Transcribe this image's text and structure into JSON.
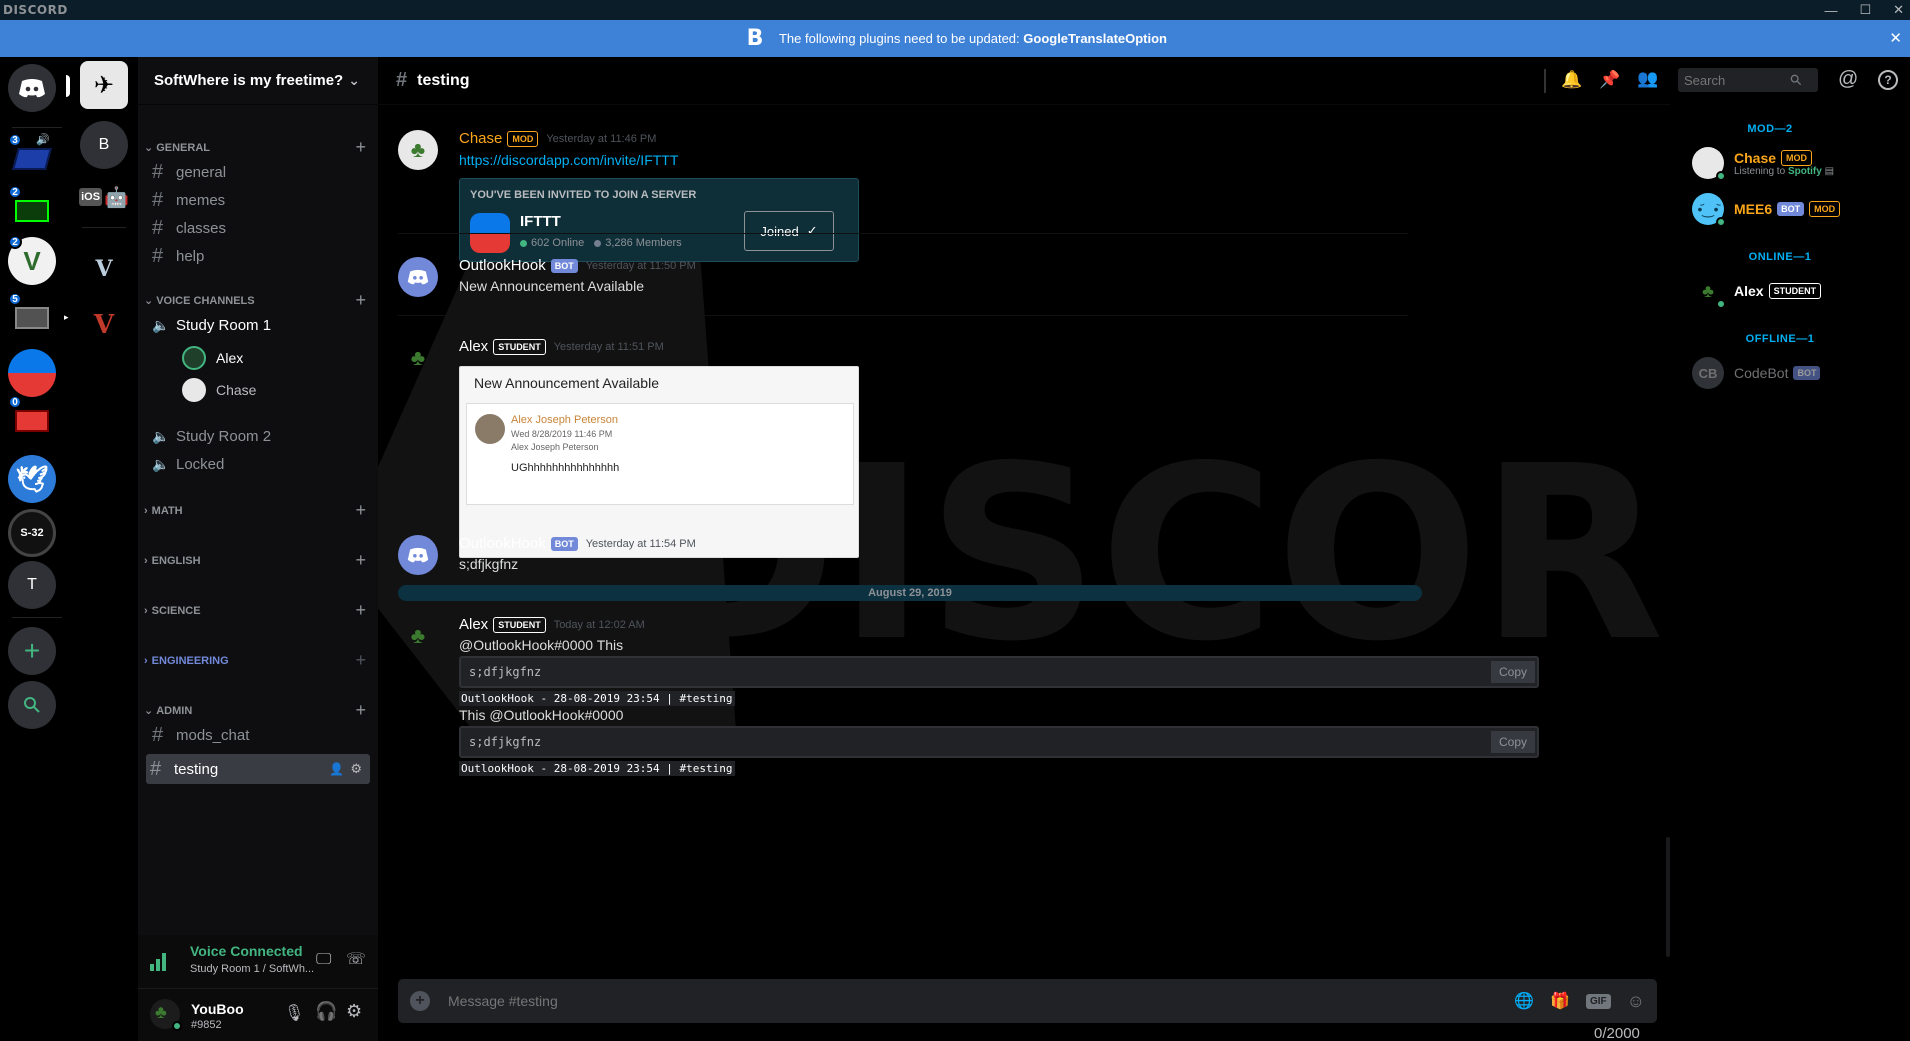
{
  "window": {
    "brand": "DISCORD",
    "minimize": "—",
    "maximize": "☐",
    "close": "✕"
  },
  "banner": {
    "logo": "B",
    "text_prefix": "The following plugins need to be updated: ",
    "plugin": "GoogleTranslateOption",
    "close": "✕"
  },
  "guilds": {
    "badges": [
      "3",
      "2",
      "2",
      "5",
      "0"
    ],
    "b_letter": "B",
    "t_letter": "T",
    "s32": "S-32",
    "ios": "iOS"
  },
  "server": {
    "name": "SoftWhere is my freetime?"
  },
  "categories": {
    "general": "GENERAL",
    "voice": "VOICE CHANNELS",
    "math": "MATH",
    "english": "ENGLISH",
    "science": "SCIENCE",
    "engineering": "ENGINEERING",
    "admin": "ADMIN"
  },
  "channels": {
    "general": "general",
    "memes": "memes",
    "classes": "classes",
    "help": "help",
    "study1": "Study Room 1",
    "study2": "Study Room 2",
    "locked": "Locked",
    "mods_chat": "mods_chat",
    "testing": "testing"
  },
  "voice_users": [
    "Alex",
    "Chase"
  ],
  "voice_status": {
    "title": "Voice Connected",
    "sub": "Study Room 1 / SoftWh..."
  },
  "user": {
    "name": "YouBoo",
    "tag": "#9852"
  },
  "header": {
    "channel": "testing",
    "search_placeholder": "Search"
  },
  "messages": {
    "m1": {
      "author": "Chase",
      "tag": "MOD",
      "time": "Yesterday at 11:46 PM",
      "link": "https://discordapp.com/invite/IFTTT",
      "invite": {
        "heading": "YOU'VE BEEN INVITED TO JOIN A SERVER",
        "server": "IFTTT",
        "online": "602 Online",
        "members": "3,286 Members",
        "button": "Joined"
      }
    },
    "m2": {
      "author": "OutlookHook",
      "tag": "BOT",
      "time": "Yesterday at 11:50 PM",
      "text": "New Announcement Available"
    },
    "m3": {
      "author": "Alex",
      "tag": "STUDENT",
      "time": "Yesterday at 11:51 PM",
      "embed": {
        "title": "New Announcement Available",
        "sender": "Alex Joseph Peterson",
        "date": "Wed 8/28/2019 11:46 PM",
        "to": "Alex Joseph Peterson",
        "body": "UGhhhhhhhhhhhhhhh"
      }
    },
    "m4": {
      "author": "OutlookHook",
      "tag": "BOT",
      "time": "Yesterday at 11:54 PM",
      "text": "s;dfjkgfnz"
    },
    "divider": "August 29, 2019",
    "m5": {
      "author": "Alex",
      "tag": "STUDENT",
      "time": "Today at 12:02 AM",
      "line1": "@OutlookHook#0000  This",
      "code1": "s;dfjkgfnz",
      "foot1": "OutlookHook - 28-08-2019 23:54 | #testing",
      "line2": "This @OutlookHook#0000",
      "code2": "s;dfjkgfnz",
      "foot2": "OutlookHook - 28-08-2019 23:54 | #testing",
      "copy": "Copy"
    }
  },
  "composer": {
    "placeholder": "Message #testing",
    "count": "0/2000",
    "gif": "GIF"
  },
  "members": {
    "mod_header": "MOD—2",
    "online_header": "ONLINE—1",
    "offline_header": "OFFLINE—1",
    "chase": {
      "name": "Chase",
      "tag": "MOD",
      "activity_prefix": "Listening to ",
      "activity": "Spotify"
    },
    "mee6": {
      "name": "MEE6",
      "tag1": "BOT",
      "tag2": "MOD"
    },
    "alex": {
      "name": "Alex",
      "tag": "STUDENT"
    },
    "codebot": {
      "name": "CodeBot",
      "tag": "BOT"
    }
  },
  "watermark": "DISCORD",
  "colors": {
    "accent": "#7289da",
    "banner": "#3e82d8",
    "online": "#43b581",
    "mod": "#faa61a",
    "link": "#00b0f4"
  }
}
